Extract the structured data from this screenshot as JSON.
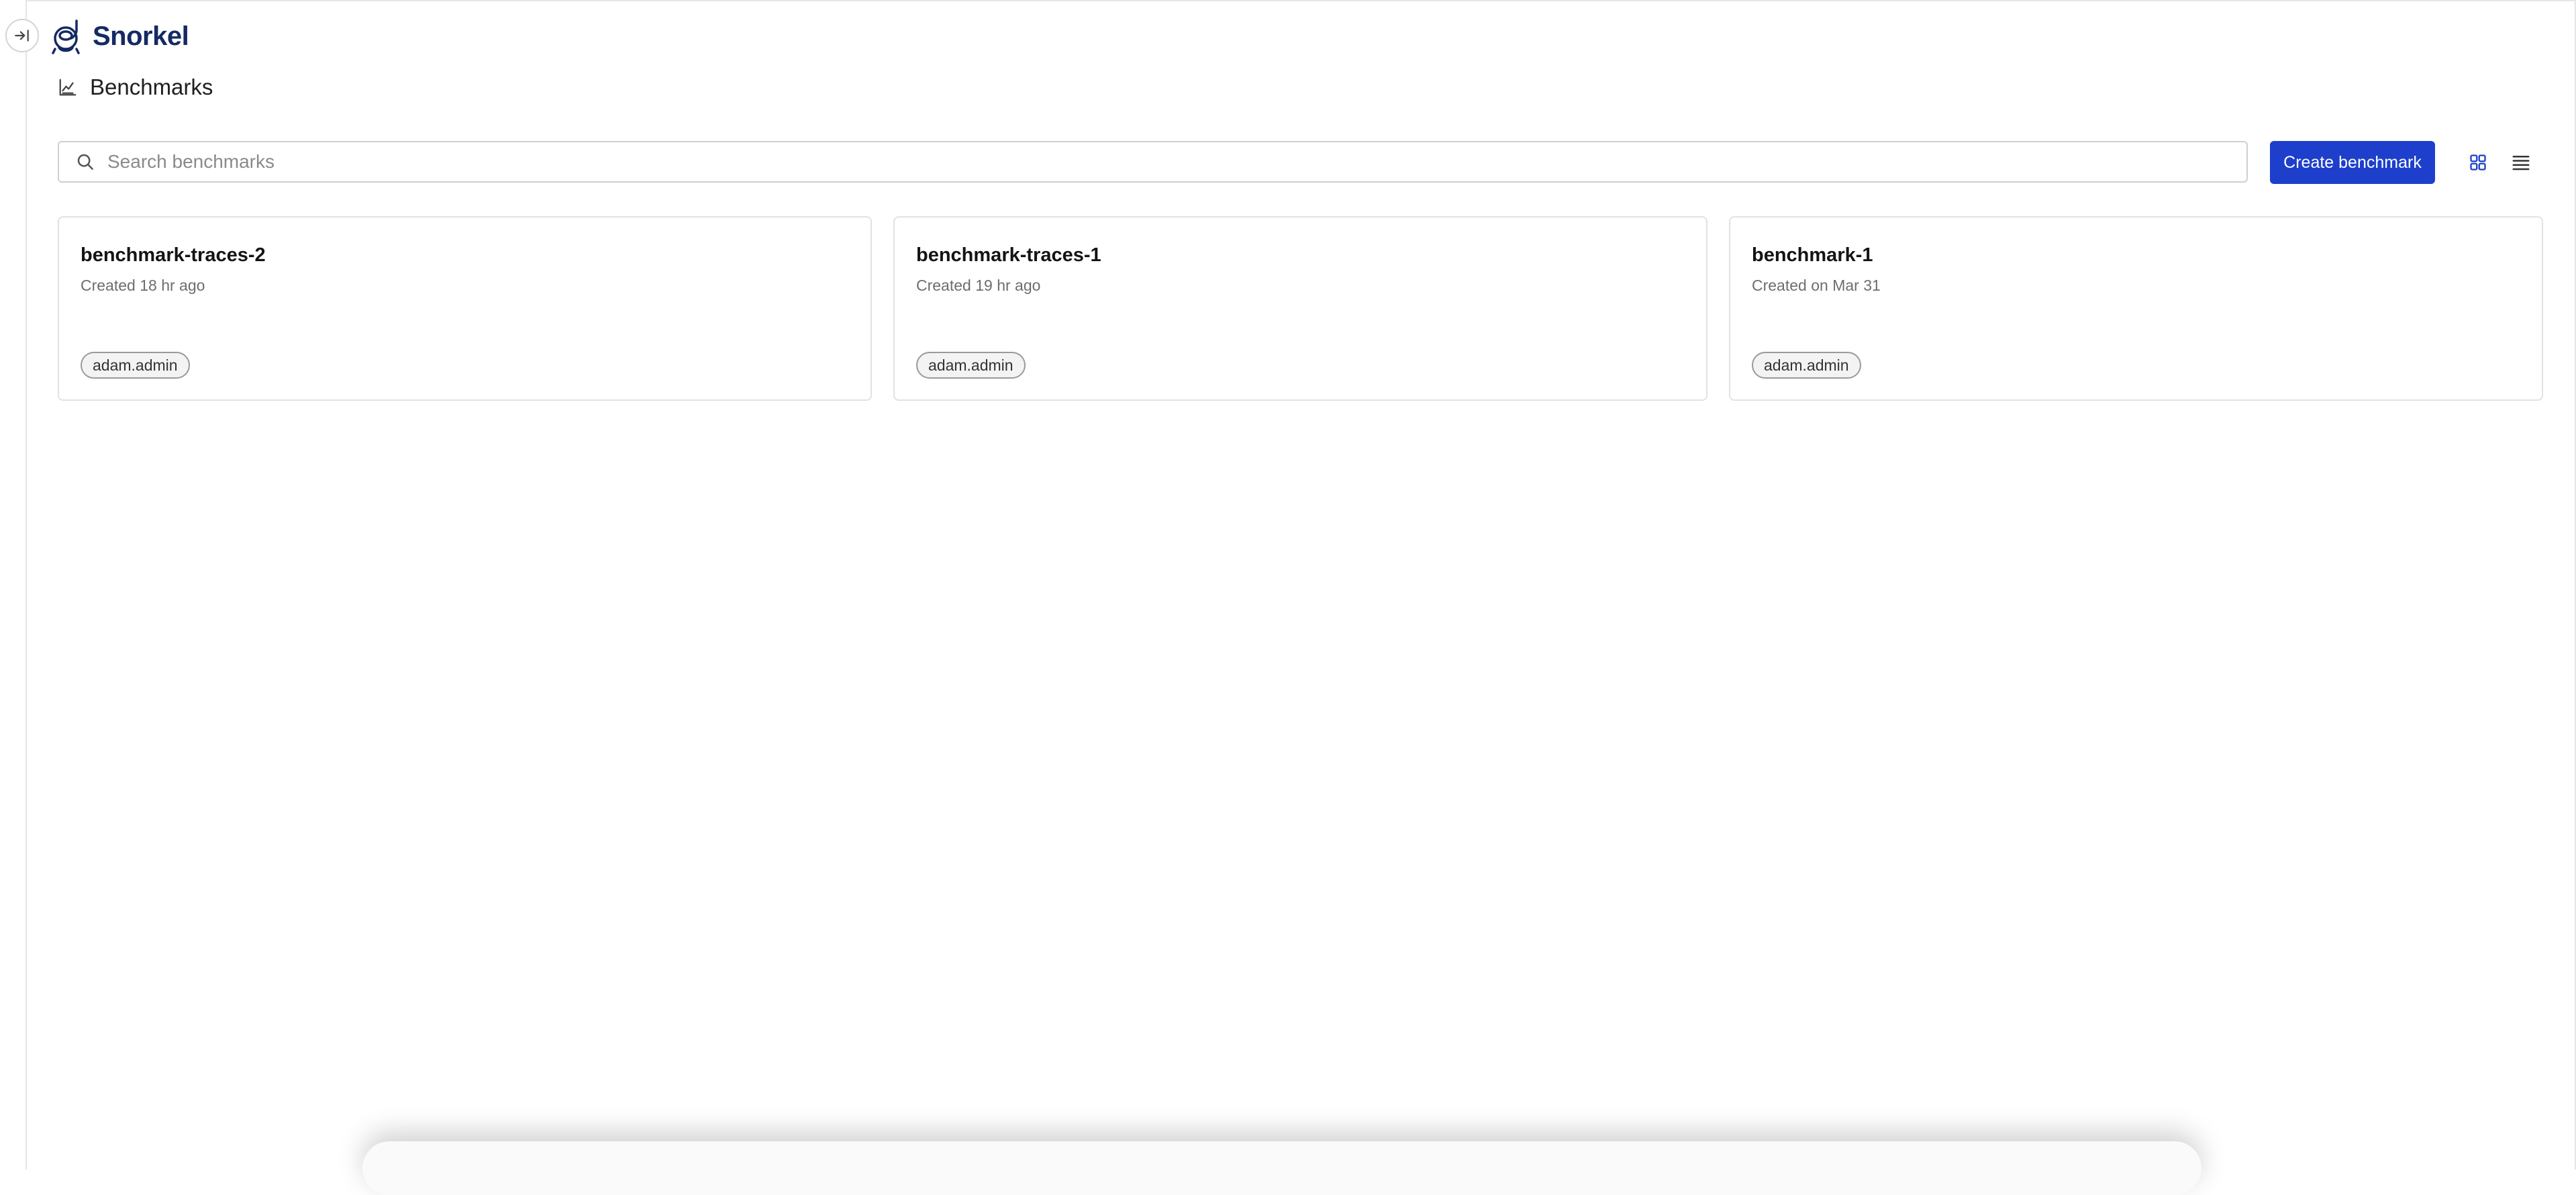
{
  "brand": {
    "name": "Snorkel"
  },
  "page": {
    "title": "Benchmarks"
  },
  "search": {
    "placeholder": "Search benchmarks",
    "value": ""
  },
  "toolbar": {
    "create_label": "Create benchmark",
    "view_modes": [
      "grid",
      "list"
    ],
    "active_view": "grid"
  },
  "benchmarks": [
    {
      "name": "benchmark-traces-2",
      "created": "Created 18 hr ago",
      "owner": "adam.admin"
    },
    {
      "name": "benchmark-traces-1",
      "created": "Created 19 hr ago",
      "owner": "adam.admin"
    },
    {
      "name": "benchmark-1",
      "created": "Created on Mar 31",
      "owner": "adam.admin"
    }
  ],
  "icons": {
    "sidebar_toggle": "expand-sidebar-icon",
    "logo": "snorkel-logo-icon",
    "page": "chart-icon",
    "search": "search-icon",
    "grid": "grid-view-icon",
    "list": "list-view-icon"
  },
  "colors": {
    "brand": "#152a63",
    "primary_button": "#1d3fcc",
    "active_view_icon": "#1d3fcc"
  }
}
